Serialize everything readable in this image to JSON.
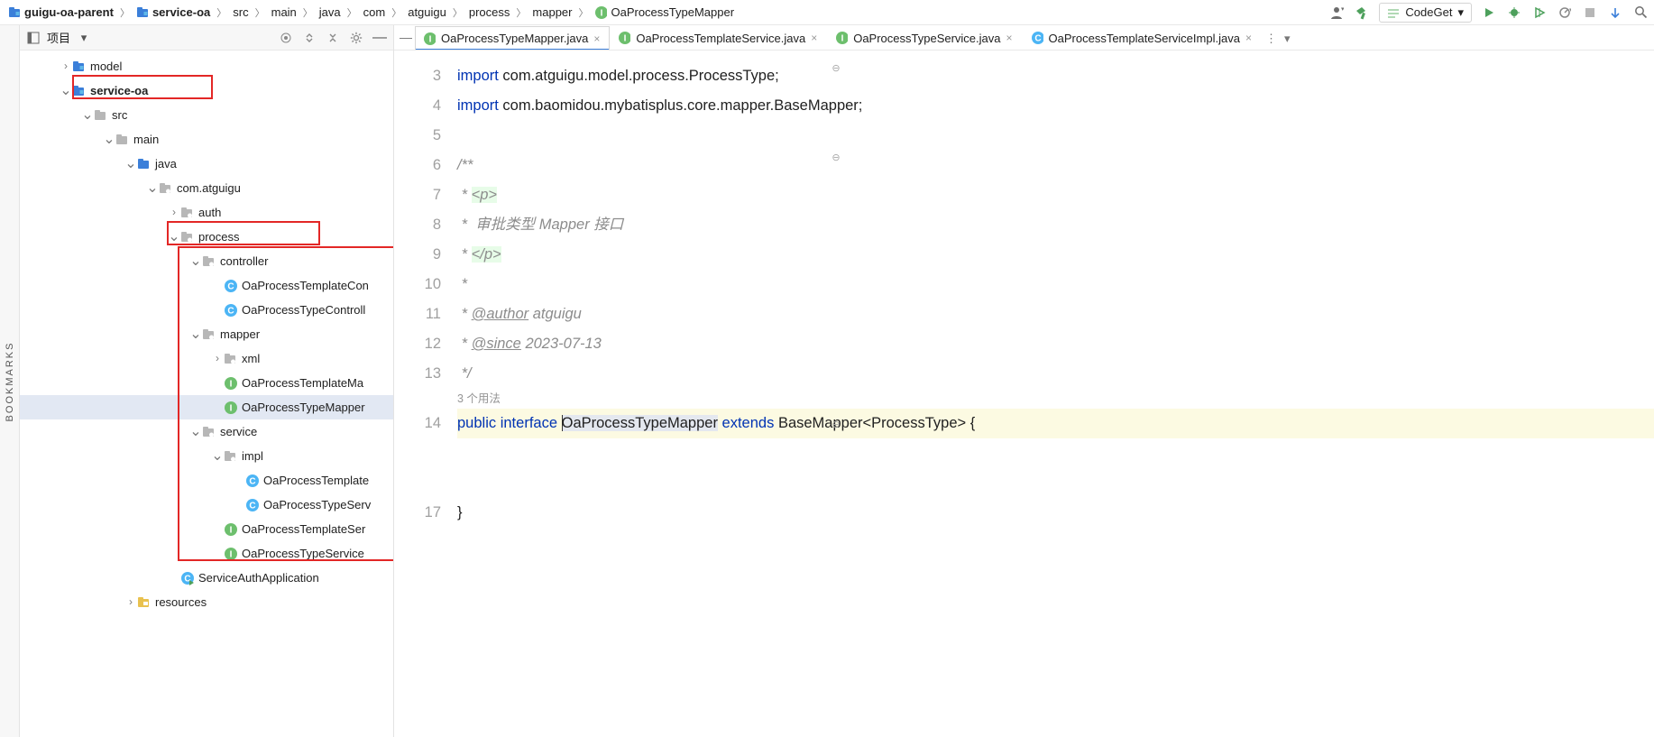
{
  "breadcrumb": {
    "items": [
      {
        "label": "guigu-oa-parent",
        "bold": true,
        "icon": "module"
      },
      {
        "label": "service-oa",
        "bold": true,
        "icon": "module"
      },
      {
        "label": "src",
        "bold": false,
        "icon": "folder"
      },
      {
        "label": "main",
        "bold": false,
        "icon": "folder"
      },
      {
        "label": "java",
        "bold": false,
        "icon": "folder"
      },
      {
        "label": "com",
        "bold": false,
        "icon": "folder"
      },
      {
        "label": "atguigu",
        "bold": false,
        "icon": "folder"
      },
      {
        "label": "process",
        "bold": false,
        "icon": "folder"
      },
      {
        "label": "mapper",
        "bold": false,
        "icon": "folder"
      },
      {
        "label": "OaProcessTypeMapper",
        "bold": false,
        "icon": "interface"
      }
    ]
  },
  "toolbar": {
    "codeget_label": "CodeGet"
  },
  "project": {
    "title": "项目",
    "tree": [
      {
        "depth": 1,
        "chev": ">",
        "icon": "module",
        "label": "model"
      },
      {
        "depth": 1,
        "chev": "v",
        "icon": "module",
        "label": "service-oa",
        "bold": true,
        "boxed": "top"
      },
      {
        "depth": 2,
        "chev": "v",
        "icon": "folder",
        "label": "src"
      },
      {
        "depth": 3,
        "chev": "v",
        "icon": "folder",
        "label": "main"
      },
      {
        "depth": 4,
        "chev": "v",
        "icon": "src",
        "label": "java"
      },
      {
        "depth": 5,
        "chev": "v",
        "icon": "pkg",
        "label": "com.atguigu"
      },
      {
        "depth": 6,
        "chev": ">",
        "icon": "pkg",
        "label": "auth"
      },
      {
        "depth": 6,
        "chev": "v",
        "icon": "pkg",
        "label": "process",
        "boxed": "mid"
      },
      {
        "depth": 7,
        "chev": "v",
        "icon": "pkg",
        "label": "controller"
      },
      {
        "depth": 8,
        "chev": "",
        "icon": "class",
        "label": "OaProcessTemplateCon"
      },
      {
        "depth": 8,
        "chev": "",
        "icon": "class",
        "label": "OaProcessTypeControll"
      },
      {
        "depth": 7,
        "chev": "v",
        "icon": "pkg",
        "label": "mapper"
      },
      {
        "depth": 8,
        "chev": ">",
        "icon": "pkg",
        "label": "xml"
      },
      {
        "depth": 8,
        "chev": "",
        "icon": "interface",
        "label": "OaProcessTemplateMa"
      },
      {
        "depth": 8,
        "chev": "",
        "icon": "interface",
        "label": "OaProcessTypeMapper",
        "selected": true
      },
      {
        "depth": 7,
        "chev": "v",
        "icon": "pkg",
        "label": "service"
      },
      {
        "depth": 8,
        "chev": "v",
        "icon": "pkg",
        "label": "impl"
      },
      {
        "depth": 9,
        "chev": "",
        "icon": "class",
        "label": "OaProcessTemplate"
      },
      {
        "depth": 9,
        "chev": "",
        "icon": "class",
        "label": "OaProcessTypeServ"
      },
      {
        "depth": 8,
        "chev": "",
        "icon": "interface",
        "label": "OaProcessTemplateSer"
      },
      {
        "depth": 8,
        "chev": "",
        "icon": "interface",
        "label": "OaProcessTypeService"
      },
      {
        "depth": 6,
        "chev": "",
        "icon": "class-run",
        "label": "ServiceAuthApplication"
      },
      {
        "depth": 4,
        "chev": ">",
        "icon": "resources",
        "label": "resources"
      }
    ]
  },
  "tabs": {
    "items": [
      {
        "label": "OaProcessTypeMapper.java",
        "icon": "interface",
        "active": true
      },
      {
        "label": "OaProcessTemplateService.java",
        "icon": "interface",
        "active": false
      },
      {
        "label": "OaProcessTypeService.java",
        "icon": "interface",
        "active": false
      },
      {
        "label": "OaProcessTemplateServiceImpl.java",
        "icon": "class",
        "active": false
      }
    ]
  },
  "code": {
    "line_numbers": [
      "3",
      "4",
      "5",
      "6",
      "7",
      "8",
      "9",
      "10",
      "11",
      "12",
      "13",
      "",
      "14",
      "",
      "",
      "",
      "17"
    ],
    "usage_hint": "3 个用法",
    "import1_kw": "import",
    "import1_rest": " com.atguigu.model.process.ProcessType;",
    "import2_kw": "import",
    "import2_rest": " com.baomidou.mybatisplus.core.mapper.BaseMapper;",
    "doc_open": "/**",
    "doc_l1a": " * ",
    "doc_l1b": "<p>",
    "doc_l2": " *  审批类型 Mapper 接口",
    "doc_l3a": " * ",
    "doc_l3b": "</p>",
    "doc_l4": " *",
    "doc_l5a": " * ",
    "doc_l5b": "@author",
    "doc_l5c": " atguigu",
    "doc_l6a": " * ",
    "doc_l6b": "@since",
    "doc_l6c": " 2023-07-13",
    "doc_close": " */",
    "sig_public": "public",
    "sig_interface": "interface",
    "sig_name": "OaProcessTypeMapper",
    "sig_extends": "extends",
    "sig_base": "BaseMapper<ProcessType> {",
    "close_brace": "}",
    "line15_blank": " ",
    "line16_blank": " "
  },
  "sidestrip": {
    "label": "BOOKMARKS"
  }
}
